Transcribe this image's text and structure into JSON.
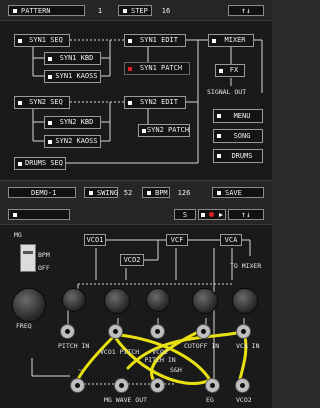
{
  "top": {
    "header": {
      "pattern_label": "PATTERN",
      "pattern_value": "1",
      "step_label": "STEP",
      "step_value": "16",
      "nav_icon": "up-down-arrows-icon",
      "nav_text": "↑↓"
    },
    "nodes": {
      "syn1_seq": "SYN1 SEQ",
      "syn1_kbd": "SYN1 KBD",
      "syn1_kaoss": "SYN1 KAOSS",
      "syn1_edit": "SYN1 EDIT",
      "syn1_patch": "SYN1 PATCH",
      "syn2_seq": "SYN2 SEQ",
      "syn2_kbd": "SYN2 KBD",
      "syn2_kaoss": "SYN2 KAOSS",
      "syn2_edit": "SYN2 EDIT",
      "syn2_patch": "SYN2 PATCH",
      "drums_seq": "DRUMS SEQ",
      "mixer": "MIXER",
      "fx": "FX",
      "signal_out": "SIGNAL OUT",
      "menu": "MENU",
      "song": "SONG",
      "drums": "DRUMS"
    },
    "footer": {
      "song_name": "DEMO-1",
      "swing_label": "SWING",
      "swing_value": "52",
      "bpm_label": "BPM",
      "bpm_value": "126",
      "save_label": "SAVE"
    }
  },
  "bottom": {
    "header": {
      "patch_name": "",
      "s_label": "S",
      "transport_icons": [
        "stop-icon",
        "record-icon",
        "play-icon"
      ],
      "nav_text": "↑↓"
    },
    "modules": {
      "vco1": "VCO1",
      "vco2": "VCO2",
      "vcf": "VCF",
      "vca": "VCA",
      "eg": "EG",
      "to_mixer": "TO MIXER"
    },
    "lfo": {
      "mg_label": "MG",
      "bpm_label": "BPM",
      "off_label": "OFF",
      "freq_label": "FREQ"
    },
    "inputs": {
      "pitch_in": "PITCH IN",
      "vco1_pitch": "VCO1 PITCH",
      "vco2_pitch": "VCO2 PITCH IN",
      "cutoff_in": "CUTOFF IN",
      "vca_in": "VCA IN"
    },
    "outputs": {
      "mg_wave_out": "MG WAVE OUT",
      "noise_label": "~",
      "sh_label": "S&H",
      "eg_out": "EG",
      "vco2_out": "VCO2"
    },
    "cable_color": "#e8e010"
  }
}
